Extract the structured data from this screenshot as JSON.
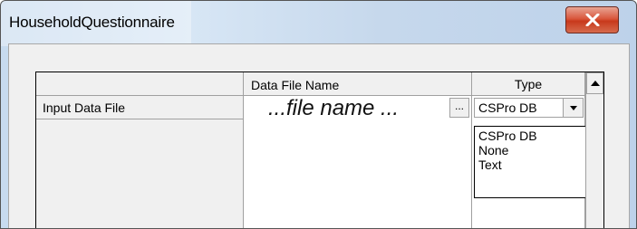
{
  "window": {
    "title": "HouseholdQuestionnaire",
    "close_icon": "close-x-icon"
  },
  "grid": {
    "columns": [
      "",
      "Data File Name",
      "Type"
    ],
    "rows": [
      {
        "label": "Input Data File",
        "file_name": "...file name ...",
        "browse_label": "...",
        "type": "CSPro DB"
      }
    ]
  },
  "type_dropdown": {
    "options": [
      "CSPro DB",
      "None",
      "Text"
    ]
  },
  "colors": {
    "title_bar": "#c8dbef",
    "close_button": "#d9573d",
    "grid_header": "#f0f0f0"
  }
}
